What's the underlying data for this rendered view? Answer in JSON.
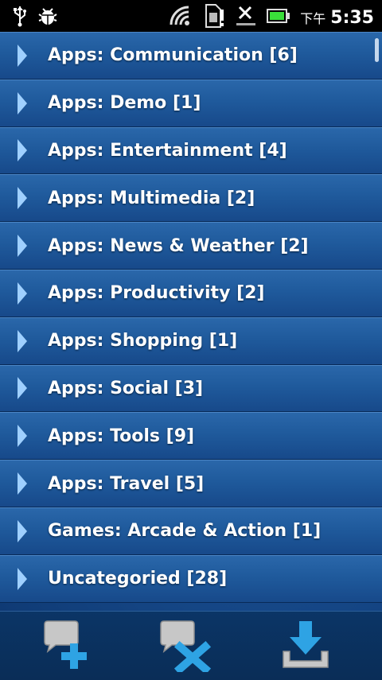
{
  "status_bar": {
    "ampm": "下午",
    "time": "5:35",
    "icons": [
      "usb-icon",
      "debug-icon",
      "wifi-icon",
      "sim-alert-icon",
      "no-signal-icon",
      "battery-icon"
    ]
  },
  "list": {
    "items": [
      {
        "label": "Apps: Communication [6]"
      },
      {
        "label": "Apps: Demo [1]"
      },
      {
        "label": "Apps: Entertainment [4]"
      },
      {
        "label": "Apps: Multimedia [2]"
      },
      {
        "label": "Apps: News & Weather [2]"
      },
      {
        "label": "Apps: Productivity [2]"
      },
      {
        "label": "Apps: Shopping [1]"
      },
      {
        "label": "Apps: Social [3]"
      },
      {
        "label": "Apps: Tools [9]"
      },
      {
        "label": "Apps: Travel [5]"
      },
      {
        "label": "Games: Arcade & Action [1]"
      },
      {
        "label": "Uncategoried [28]"
      }
    ]
  },
  "toolbar": {
    "buttons": [
      "add-comment-icon",
      "remove-comment-icon",
      "download-icon"
    ]
  },
  "colors": {
    "row_top": "#2a67aa",
    "row_bottom": "#17498a",
    "chevron": "#9fd0ff",
    "toolbar": "#0b3566"
  }
}
